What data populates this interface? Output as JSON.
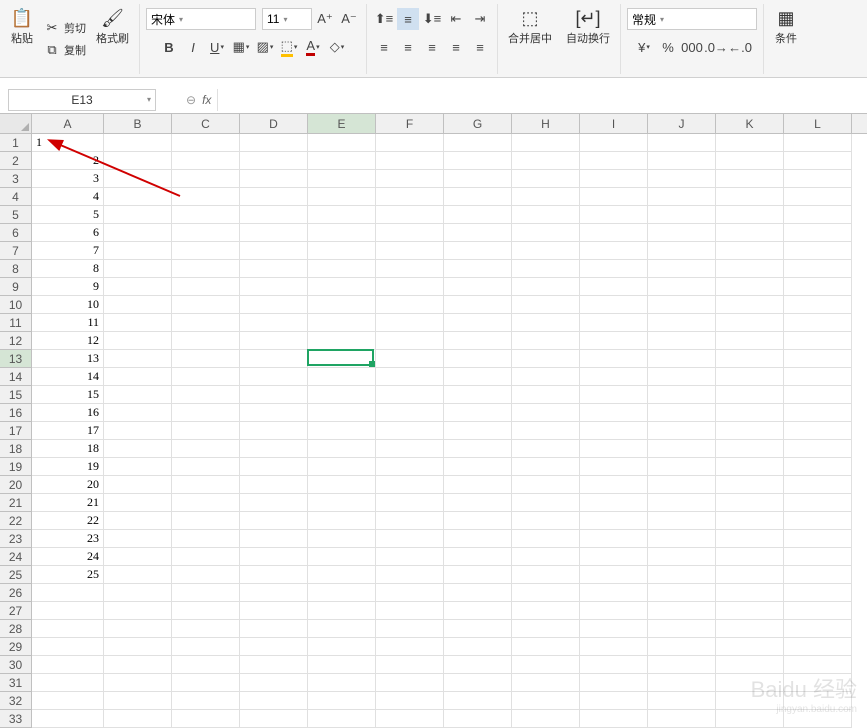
{
  "ribbon": {
    "paste": "粘贴",
    "cut": "剪切",
    "copy": "复制",
    "format_painter": "格式刷",
    "font_name": "宋体",
    "font_size": "11",
    "merge": "合并居中",
    "wrap": "自动换行",
    "number_format": "常规",
    "cond": "条件"
  },
  "name_box": "E13",
  "columns": [
    "A",
    "B",
    "C",
    "D",
    "E",
    "F",
    "G",
    "H",
    "I",
    "J",
    "K",
    "L"
  ],
  "col_widths": {
    "A": 72,
    "default": 68
  },
  "selected_cell": {
    "col": "E",
    "row": 13
  },
  "selected_col_index": 4,
  "selected_row": 13,
  "row_count": 33,
  "data_a": [
    "1",
    "2",
    "3",
    "4",
    "5",
    "6",
    "7",
    "8",
    "9",
    "10",
    "11",
    "12",
    "13",
    "14",
    "15",
    "16",
    "17",
    "18",
    "19",
    "20",
    "21",
    "22",
    "23",
    "24",
    "25"
  ],
  "a1_align": "left",
  "watermark": {
    "main": "Baidu 经验",
    "sub": "jingyan.baidu.com"
  }
}
